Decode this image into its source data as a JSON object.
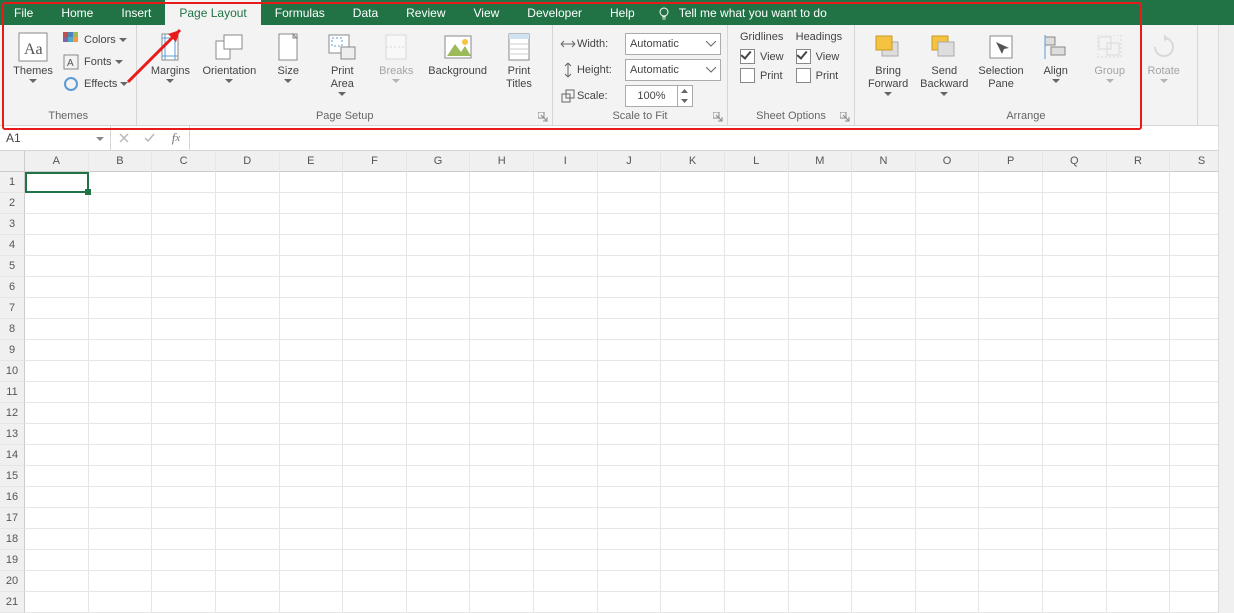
{
  "tabs": [
    "File",
    "Home",
    "Insert",
    "Page Layout",
    "Formulas",
    "Data",
    "Review",
    "View",
    "Developer",
    "Help"
  ],
  "active_tab": "Page Layout",
  "tell_me": "Tell me what you want to do",
  "groups": {
    "themes": {
      "label": "Themes",
      "themes_btn": "Themes",
      "colors": "Colors",
      "fonts": "Fonts",
      "effects": "Effects"
    },
    "page_setup": {
      "label": "Page Setup",
      "margins": "Margins",
      "orientation": "Orientation",
      "size": "Size",
      "print_area": "Print\nArea",
      "breaks": "Breaks",
      "background": "Background",
      "print_titles": "Print\nTitles"
    },
    "scale": {
      "label": "Scale to Fit",
      "width_lbl": "Width:",
      "height_lbl": "Height:",
      "scale_lbl": "Scale:",
      "width_val": "Automatic",
      "height_val": "Automatic",
      "scale_val": "100%"
    },
    "sheet": {
      "label": "Sheet Options",
      "gridlines": "Gridlines",
      "headings": "Headings",
      "view": "View",
      "print": "Print",
      "gl_view": true,
      "gl_print": false,
      "hd_view": true,
      "hd_print": false
    },
    "arrange": {
      "label": "Arrange",
      "bring": "Bring\nForward",
      "send": "Send\nBackward",
      "sel": "Selection\nPane",
      "align": "Align",
      "group": "Group",
      "rotate": "Rotate"
    }
  },
  "namebox": "A1",
  "formula": "",
  "columns": [
    "A",
    "B",
    "C",
    "D",
    "E",
    "F",
    "G",
    "H",
    "I",
    "J",
    "K",
    "L",
    "M",
    "N",
    "O",
    "P",
    "Q",
    "R",
    "S"
  ],
  "row_count": 21,
  "selected": {
    "row": 1,
    "col": "A"
  }
}
